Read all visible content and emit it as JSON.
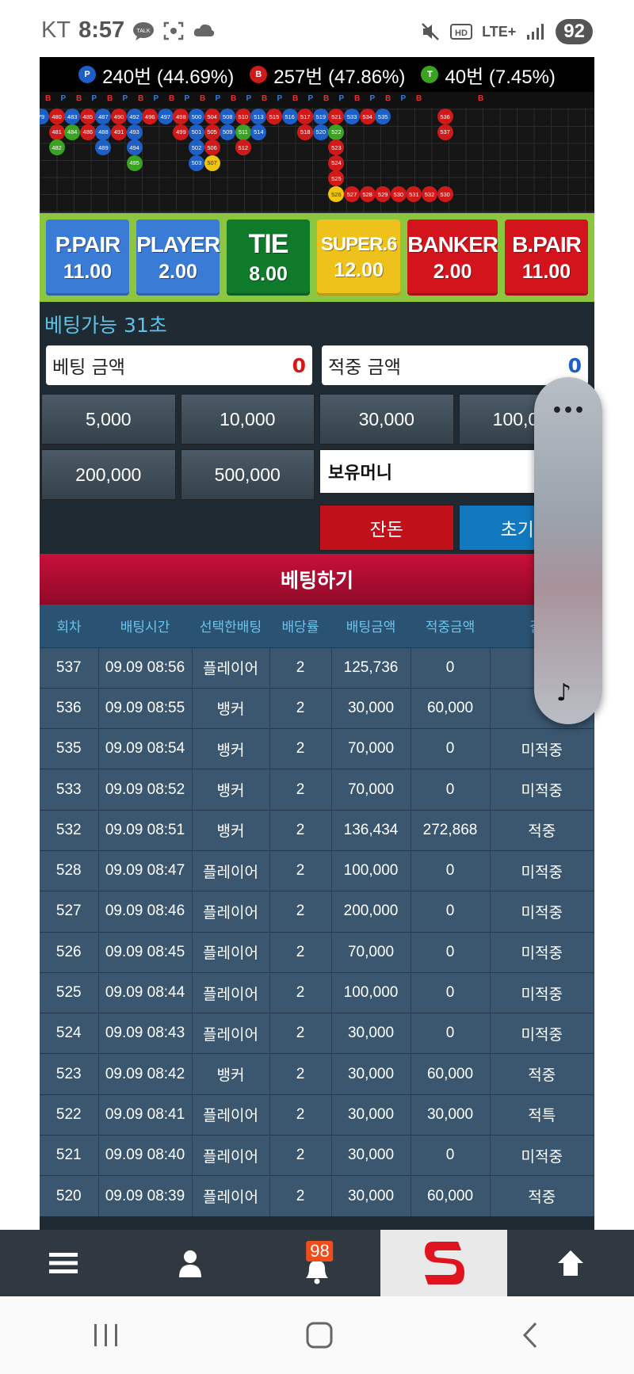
{
  "status": {
    "carrier": "KT",
    "time": "8:57",
    "network": "LTE+",
    "battery": "92"
  },
  "stats": [
    {
      "mark": "P",
      "color": "#1d5fc7",
      "text": "240번 (44.69%)"
    },
    {
      "mark": "B",
      "color": "#d01a1a",
      "text": "257번 (47.86%)"
    },
    {
      "mark": "T",
      "color": "#3aa321",
      "text": "40번 (7.45%)"
    }
  ],
  "road": {
    "header": [
      "B",
      "P",
      "B",
      "P",
      "B",
      "P",
      "B",
      "P",
      "B",
      "P",
      "B",
      "P",
      "B",
      "P",
      "B",
      "P",
      "B",
      "P",
      "B",
      "P",
      "B",
      "P",
      "B",
      "P",
      "B",
      "",
      "",
      "",
      "B"
    ],
    "beads": [
      {
        "c": 0,
        "r": 0,
        "n": "79",
        "t": "P"
      },
      {
        "c": 1,
        "r": 0,
        "n": "480",
        "t": "B"
      },
      {
        "c": 1,
        "r": 1,
        "n": "481",
        "t": "B"
      },
      {
        "c": 1,
        "r": 2,
        "n": "482",
        "t": "T"
      },
      {
        "c": 2,
        "r": 0,
        "n": "483",
        "t": "P"
      },
      {
        "c": 2,
        "r": 1,
        "n": "484",
        "t": "T"
      },
      {
        "c": 3,
        "r": 0,
        "n": "485",
        "t": "B"
      },
      {
        "c": 3,
        "r": 1,
        "n": "486",
        "t": "B"
      },
      {
        "c": 4,
        "r": 0,
        "n": "487",
        "t": "P"
      },
      {
        "c": 4,
        "r": 1,
        "n": "488",
        "t": "P"
      },
      {
        "c": 4,
        "r": 2,
        "n": "489",
        "t": "P"
      },
      {
        "c": 5,
        "r": 0,
        "n": "490",
        "t": "B"
      },
      {
        "c": 5,
        "r": 1,
        "n": "491",
        "t": "B"
      },
      {
        "c": 6,
        "r": 0,
        "n": "492",
        "t": "P"
      },
      {
        "c": 6,
        "r": 1,
        "n": "493",
        "t": "P"
      },
      {
        "c": 6,
        "r": 2,
        "n": "494",
        "t": "P"
      },
      {
        "c": 6,
        "r": 3,
        "n": "495",
        "t": "T"
      },
      {
        "c": 7,
        "r": 0,
        "n": "496",
        "t": "B"
      },
      {
        "c": 8,
        "r": 0,
        "n": "497",
        "t": "P"
      },
      {
        "c": 9,
        "r": 0,
        "n": "498",
        "t": "B"
      },
      {
        "c": 9,
        "r": 1,
        "n": "499",
        "t": "B"
      },
      {
        "c": 10,
        "r": 0,
        "n": "500",
        "t": "P"
      },
      {
        "c": 10,
        "r": 1,
        "n": "501",
        "t": "P"
      },
      {
        "c": 10,
        "r": 2,
        "n": "502",
        "t": "P"
      },
      {
        "c": 10,
        "r": 3,
        "n": "503",
        "t": "P"
      },
      {
        "c": 11,
        "r": 0,
        "n": "504",
        "t": "B"
      },
      {
        "c": 11,
        "r": 1,
        "n": "505",
        "t": "B"
      },
      {
        "c": 11,
        "r": 2,
        "n": "506",
        "t": "B"
      },
      {
        "c": 11,
        "r": 3,
        "n": "507",
        "t": "Y"
      },
      {
        "c": 12,
        "r": 0,
        "n": "508",
        "t": "P"
      },
      {
        "c": 12,
        "r": 1,
        "n": "509",
        "t": "P"
      },
      {
        "c": 13,
        "r": 0,
        "n": "510",
        "t": "B"
      },
      {
        "c": 13,
        "r": 1,
        "n": "511",
        "t": "T"
      },
      {
        "c": 13,
        "r": 2,
        "n": "512",
        "t": "B"
      },
      {
        "c": 14,
        "r": 0,
        "n": "513",
        "t": "P"
      },
      {
        "c": 14,
        "r": 1,
        "n": "514",
        "t": "P"
      },
      {
        "c": 15,
        "r": 0,
        "n": "515",
        "t": "B"
      },
      {
        "c": 16,
        "r": 0,
        "n": "516",
        "t": "P"
      },
      {
        "c": 17,
        "r": 0,
        "n": "517",
        "t": "B"
      },
      {
        "c": 17,
        "r": 1,
        "n": "518",
        "t": "B"
      },
      {
        "c": 18,
        "r": 0,
        "n": "519",
        "t": "P"
      },
      {
        "c": 18,
        "r": 1,
        "n": "520",
        "t": "P"
      },
      {
        "c": 19,
        "r": 0,
        "n": "521",
        "t": "B"
      },
      {
        "c": 19,
        "r": 1,
        "n": "522",
        "t": "T"
      },
      {
        "c": 19,
        "r": 2,
        "n": "523",
        "t": "B"
      },
      {
        "c": 19,
        "r": 3,
        "n": "524",
        "t": "B"
      },
      {
        "c": 19,
        "r": 4,
        "n": "525",
        "t": "B"
      },
      {
        "c": 19,
        "r": 5,
        "n": "526",
        "t": "Y"
      },
      {
        "c": 20,
        "r": 0,
        "n": "533",
        "t": "P"
      },
      {
        "c": 20,
        "r": 5,
        "n": "527",
        "t": "B"
      },
      {
        "c": 21,
        "r": 0,
        "n": "534",
        "t": "B"
      },
      {
        "c": 21,
        "r": 5,
        "n": "528",
        "t": "B"
      },
      {
        "c": 22,
        "r": 0,
        "n": "535",
        "t": "P"
      },
      {
        "c": 22,
        "r": 5,
        "n": "529",
        "t": "B"
      },
      {
        "c": 23,
        "r": 5,
        "n": "530",
        "t": "B"
      },
      {
        "c": 24,
        "r": 5,
        "n": "531",
        "t": "B"
      },
      {
        "c": 25,
        "r": 5,
        "n": "532",
        "t": "B"
      },
      {
        "c": 26,
        "r": 0,
        "n": "536",
        "t": "B"
      },
      {
        "c": 26,
        "r": 1,
        "n": "537",
        "t": "B"
      },
      {
        "c": 26,
        "r": 5,
        "n": "530",
        "t": "B"
      }
    ]
  },
  "bet_options": [
    {
      "name": "P.PAIR",
      "odds": "11.00",
      "color": "blue"
    },
    {
      "name": "PLAYER",
      "odds": "2.00",
      "color": "blue"
    },
    {
      "name": "TIE",
      "odds": "8.00",
      "color": "green"
    },
    {
      "name": "SUPER.6",
      "odds": "12.00",
      "color": "yellow"
    },
    {
      "name": "BANKER",
      "odds": "2.00",
      "color": "red"
    },
    {
      "name": "B.PAIR",
      "odds": "11.00",
      "color": "red"
    }
  ],
  "timer": "베팅가능 31초",
  "bet_amount": {
    "label": "베팅 금액",
    "value": "0",
    "color": "#d01a1a"
  },
  "win_amount": {
    "label": "적중 금액",
    "value": "0",
    "color": "#1d5fc7"
  },
  "chips": [
    "5,000",
    "10,000",
    "30,000",
    "100,000",
    "200,000",
    "500,000"
  ],
  "balance_label": "보유머니",
  "cancel_label": "잔돈",
  "reset_label": "초기화",
  "place_bet_label": "베팅하기",
  "history": {
    "headers": [
      "회차",
      "배팅시간",
      "선택한배팅",
      "배당률",
      "배팅금액",
      "적중금액",
      "결과"
    ],
    "rows": [
      {
        "round": "537",
        "time": "09.09 08:56",
        "pick": "플레이어",
        "odds": "2",
        "bet": "125,736",
        "win": "0",
        "result": "",
        "rc": ""
      },
      {
        "round": "536",
        "time": "09.09 08:55",
        "pick": "뱅커",
        "odds": "2",
        "bet": "30,000",
        "win": "60,000",
        "result": "",
        "rc": ""
      },
      {
        "round": "535",
        "time": "09.09 08:54",
        "pick": "뱅커",
        "odds": "2",
        "bet": "70,000",
        "win": "0",
        "result": "미적중",
        "rc": "lose"
      },
      {
        "round": "533",
        "time": "09.09 08:52",
        "pick": "뱅커",
        "odds": "2",
        "bet": "70,000",
        "win": "0",
        "result": "미적중",
        "rc": "lose"
      },
      {
        "round": "532",
        "time": "09.09 08:51",
        "pick": "뱅커",
        "odds": "2",
        "bet": "136,434",
        "win": "272,868",
        "result": "적중",
        "rc": "win"
      },
      {
        "round": "528",
        "time": "09.09 08:47",
        "pick": "플레이어",
        "odds": "2",
        "bet": "100,000",
        "win": "0",
        "result": "미적중",
        "rc": "lose"
      },
      {
        "round": "527",
        "time": "09.09 08:46",
        "pick": "플레이어",
        "odds": "2",
        "bet": "200,000",
        "win": "0",
        "result": "미적중",
        "rc": "lose"
      },
      {
        "round": "526",
        "time": "09.09 08:45",
        "pick": "플레이어",
        "odds": "2",
        "bet": "70,000",
        "win": "0",
        "result": "미적중",
        "rc": "lose"
      },
      {
        "round": "525",
        "time": "09.09 08:44",
        "pick": "플레이어",
        "odds": "2",
        "bet": "100,000",
        "win": "0",
        "result": "미적중",
        "rc": "lose"
      },
      {
        "round": "524",
        "time": "09.09 08:43",
        "pick": "플레이어",
        "odds": "2",
        "bet": "30,000",
        "win": "0",
        "result": "미적중",
        "rc": "lose"
      },
      {
        "round": "523",
        "time": "09.09 08:42",
        "pick": "뱅커",
        "odds": "2",
        "bet": "30,000",
        "win": "60,000",
        "result": "적중",
        "rc": "win"
      },
      {
        "round": "522",
        "time": "09.09 08:41",
        "pick": "플레이어",
        "odds": "2",
        "bet": "30,000",
        "win": "30,000",
        "result": "적특",
        "rc": "tie"
      },
      {
        "round": "521",
        "time": "09.09 08:40",
        "pick": "플레이어",
        "odds": "2",
        "bet": "30,000",
        "win": "0",
        "result": "미적중",
        "rc": "lose"
      },
      {
        "round": "520",
        "time": "09.09 08:39",
        "pick": "플레이어",
        "odds": "2",
        "bet": "30,000",
        "win": "60,000",
        "result": "적중",
        "rc": "win"
      }
    ]
  },
  "nav": {
    "notification_count": "98"
  }
}
